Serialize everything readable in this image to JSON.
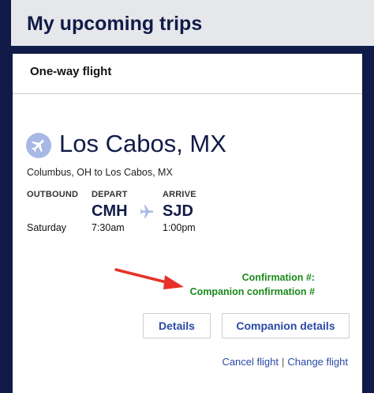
{
  "page": {
    "title": "My upcoming trips"
  },
  "trip": {
    "type": "One-way flight",
    "destination": "Los Cabos, MX",
    "route": "Columbus, OH to Los Cabos, MX",
    "outbound_label": "OUTBOUND",
    "depart_label": "DEPART",
    "arrive_label": "ARRIVE",
    "day": "Saturday",
    "depart_code": "CMH",
    "depart_time": "7:30am",
    "arrive_code": "SJD",
    "arrive_time": "1:00pm",
    "confirmation": "Confirmation #:",
    "companion_confirmation": "Companion confirmation #"
  },
  "buttons": {
    "details": "Details",
    "companion_details": "Companion details"
  },
  "links": {
    "cancel": "Cancel flight",
    "separator": "|",
    "change": "Change flight"
  },
  "icons": {
    "destination": "airplane-icon",
    "route": "airplane-icon",
    "annotation": "red-arrow"
  },
  "colors": {
    "navy": "#111b47",
    "link": "#2a4aa4",
    "confirm_green": "#1b8a1b",
    "arrow_red": "#e8312a",
    "header_bg": "#e6e7eb"
  }
}
